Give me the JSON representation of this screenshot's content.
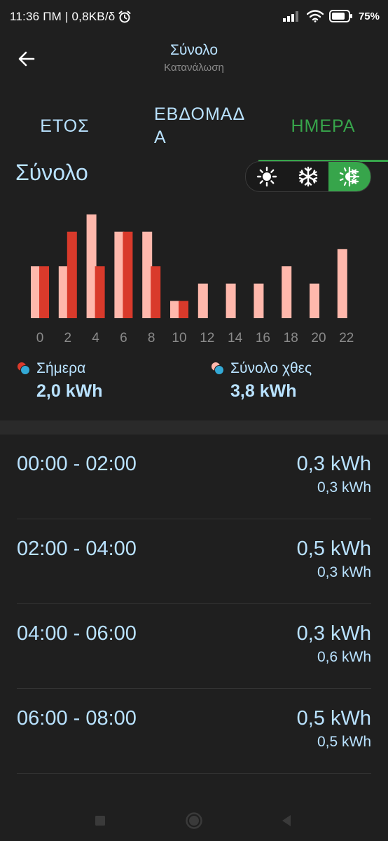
{
  "status_bar": {
    "time_speed": "11:36 ΠΜ | 0,8KB/δ",
    "battery": "75%",
    "icons": [
      "alarm-icon",
      "signal-icon",
      "wifi-icon",
      "battery-icon"
    ]
  },
  "header": {
    "title": "Σύνολο",
    "subtitle": "Κατανάλωση",
    "back_icon": "arrow-left-icon"
  },
  "tabs": [
    {
      "label": "ΕΤΟΣ",
      "active": false
    },
    {
      "label": "ΕΒΔΟΜΑΔ\nΑ",
      "active": false
    },
    {
      "label": "ΗΜΕΡΑ",
      "active": true
    }
  ],
  "section": {
    "title": "Σύνολο",
    "modes": [
      {
        "icon": "sun-icon",
        "active": false
      },
      {
        "icon": "snowflake-icon",
        "active": false
      },
      {
        "icon": "sun-snowflake-icon",
        "active": true
      }
    ]
  },
  "colors": {
    "accent": "#37a54b",
    "today": "#d93a2b",
    "yesterday": "#ffb8ac",
    "text": "#b9e2ff",
    "background": "#1f1f1f"
  },
  "chart_data": {
    "type": "bar",
    "categories": [
      "0",
      "2",
      "4",
      "6",
      "8",
      "10",
      "12",
      "14",
      "16",
      "18",
      "20",
      "22"
    ],
    "series": [
      {
        "name": "Σύνολο χθες",
        "values": [
          0.3,
          0.3,
          0.6,
          0.5,
          0.5,
          0.1,
          0.2,
          0.2,
          0.2,
          0.3,
          0.2,
          0.4
        ]
      },
      {
        "name": "Σήμερα",
        "values": [
          0.3,
          0.5,
          0.3,
          0.5,
          0.3,
          0.1,
          null,
          null,
          null,
          null,
          null,
          null
        ]
      }
    ],
    "ylim": [
      0,
      0.6
    ]
  },
  "legend": [
    {
      "label": "Σήμερα",
      "value": "2,0 kWh"
    },
    {
      "label": "Σύνολο χθες",
      "value": "3,8 kWh"
    }
  ],
  "rows": [
    {
      "time": "00:00 - 02:00",
      "value": "0,3 kWh",
      "sub": "0,3 kWh"
    },
    {
      "time": "02:00 - 04:00",
      "value": "0,5 kWh",
      "sub": "0,3 kWh"
    },
    {
      "time": "04:00 - 06:00",
      "value": "0,3 kWh",
      "sub": "0,6 kWh"
    },
    {
      "time": "06:00 - 08:00",
      "value": "0,5 kWh",
      "sub": "0,5 kWh"
    }
  ],
  "nav": [
    "square-icon",
    "circle-icon",
    "triangle-back-icon"
  ]
}
